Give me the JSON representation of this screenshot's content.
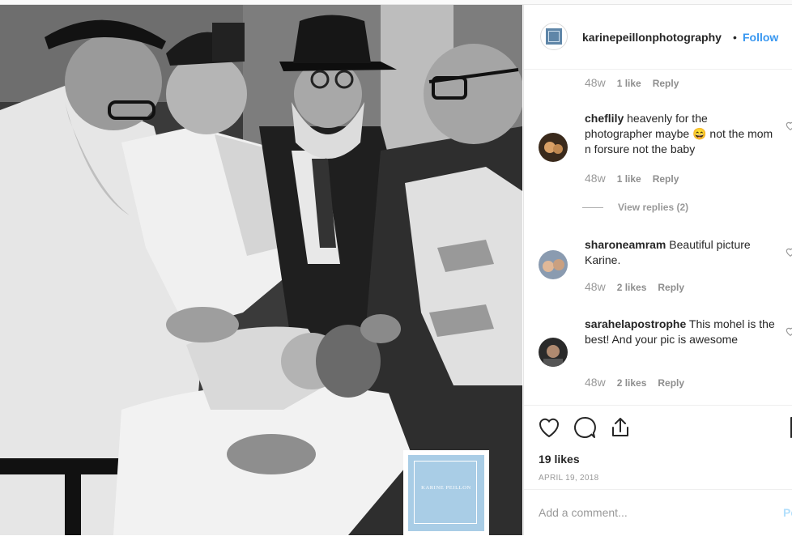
{
  "post": {
    "username": "karinepeillonphotography",
    "separator": "•",
    "follow_label": "Follow",
    "watermark_text": "KARINE PEILLON",
    "likes_label": "19 likes",
    "date": "APRIL 19, 2018",
    "add_comment_placeholder": "Add a comment...",
    "post_label": "Po"
  },
  "comments": [
    {
      "username": "",
      "text": "",
      "age": "48w",
      "likes": "1 like",
      "reply": "Reply"
    },
    {
      "username": "cheflily",
      "text": "heavenly for the photographer maybe 😄 not the mom n forsure not the baby",
      "age": "48w",
      "likes": "1 like",
      "reply": "Reply"
    },
    {
      "username": "sharoneamram",
      "text": "Beautiful picture Karine.",
      "age": "48w",
      "likes": "2 likes",
      "reply": "Reply"
    },
    {
      "username": "sarahelapostrophe",
      "text": "This mohel is the best! And your pic is awesome",
      "age": "48w",
      "likes": "2 likes",
      "reply": "Reply"
    }
  ],
  "view_replies_label": "View replies (2)",
  "colors": {
    "accent": "#3897f0",
    "muted": "#999999",
    "text": "#262626",
    "watermark": "#a9cde6"
  }
}
